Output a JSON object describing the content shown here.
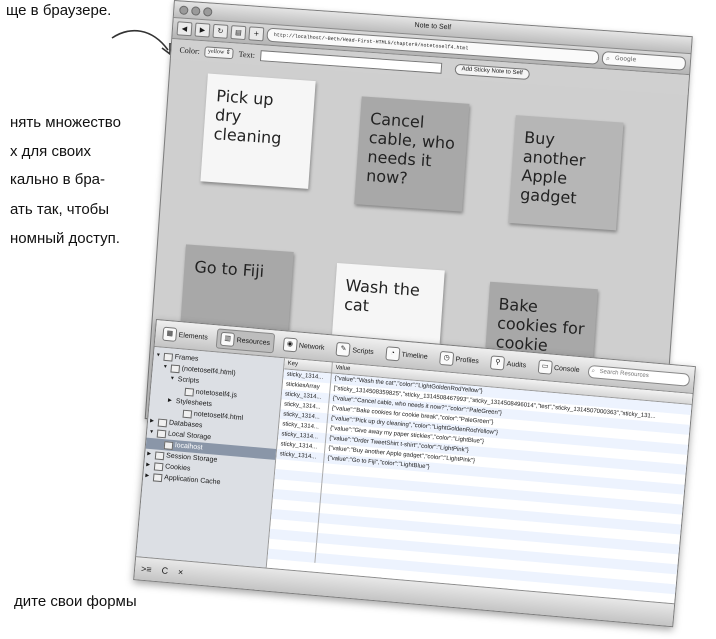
{
  "book": {
    "line1": "ще в браузере.",
    "line2": "нять множество",
    "line3": "х для своих",
    "line4": "кально в бра-",
    "line5": "ать так, чтобы",
    "line6": "номный доступ.",
    "line7": "дите свои формы"
  },
  "browser": {
    "title": "Note to Self",
    "url": "http://localhost/~Beth/Head-First-HTML5/chapter9/notetoself4.html",
    "search_placeholder": "Google",
    "nav_icons": [
      "back-icon",
      "forward-icon",
      "reload-icon",
      "bookmarks-icon",
      "add-bookmark-icon"
    ],
    "form": {
      "color_label": "Color:",
      "color_value": "yellow",
      "text_label": "Text:",
      "text_value": "",
      "add_button": "Add Sticky Note to Self"
    },
    "notes": [
      {
        "text": "Pick up dry cleaning",
        "color": "#f6f6f6"
      },
      {
        "text": "Cancel cable, who needs it now?",
        "color": "#a8a8a8"
      },
      {
        "text": "Buy another Apple gadget",
        "color": "#b6b6b6"
      },
      {
        "text": "Go to Fiji",
        "color": "#a8a8a8"
      },
      {
        "text": "Wash the cat",
        "color": "#f6f6f6"
      },
      {
        "text": "Bake cookies for cookie break",
        "color": "#a8a8a8"
      }
    ]
  },
  "devtools": {
    "tabs": [
      {
        "label": "Elements",
        "icon": "elements-icon"
      },
      {
        "label": "Resources",
        "icon": "resources-icon"
      },
      {
        "label": "Network",
        "icon": "network-icon"
      },
      {
        "label": "Scripts",
        "icon": "scripts-icon"
      },
      {
        "label": "Timeline",
        "icon": "timeline-icon"
      },
      {
        "label": "Profiles",
        "icon": "profiles-icon"
      },
      {
        "label": "Audits",
        "icon": "audits-icon"
      },
      {
        "label": "Console",
        "icon": "console-icon"
      }
    ],
    "search_placeholder": "Search Resources",
    "tree": [
      {
        "label": "Frames",
        "level": 0
      },
      {
        "label": "(notetoself4.html)",
        "level": 1
      },
      {
        "label": "Scripts",
        "level": 2
      },
      {
        "label": "notetoself4.js",
        "level": 3
      },
      {
        "label": "Stylesheets",
        "level": 2
      },
      {
        "label": "notetoself4.html",
        "level": 3
      },
      {
        "label": "Databases",
        "level": 0
      },
      {
        "label": "Local Storage",
        "level": 0
      },
      {
        "label": "localhost",
        "level": 1,
        "selected": true
      },
      {
        "label": "Session Storage",
        "level": 0
      },
      {
        "label": "Cookies",
        "level": 0
      },
      {
        "label": "Application Cache",
        "level": 0
      }
    ],
    "columns": {
      "key": "Key",
      "value": "Value"
    },
    "rows": [
      {
        "key": "sticky_1314...",
        "value": "{\"value\":\"Wash the cat\",\"color\":\"LightGoldenRodYellow\"}"
      },
      {
        "key": "stickiesArray",
        "value": "[\"sticky_1314508359825\",\"sticky_1314508467993\",\"sticky_1314508496014\",\"test\",\"sticky_1314507000363\",\"sticky_131..."
      },
      {
        "key": "sticky_1314...",
        "value": "{\"value\":\"Cancel cable, who needs it now?\",\"color\":\"PaleGreen\"}"
      },
      {
        "key": "sticky_1314...",
        "value": "{\"value\":\"Bake cookies for cookie break\",\"color\":\"PaleGreen\"}"
      },
      {
        "key": "sticky_1314...",
        "value": "{\"value\":\"Pick up dry cleaning\",\"color\":\"LightGoldenRodYellow\"}"
      },
      {
        "key": "sticky_1314...",
        "value": "{\"value\":\"Give away my paper stickies\",\"color\":\"LightBlue\"}"
      },
      {
        "key": "sticky_1314...",
        "value": "{\"value\":\"Order TweetShirt t-shirt\",\"color\":\"LightPink\"}"
      },
      {
        "key": "sticky_1314...",
        "value": "{\"value\":\"Buy another Apple gadget\",\"color\":\"LightPink\"}"
      },
      {
        "key": "sticky_1314...",
        "value": "{\"value\":\"Go to Fiji\",\"color\":\"LightBlue\"}"
      }
    ],
    "footer": {
      "refresh": "C",
      "delete": "×",
      "console_toggle": ">≡"
    }
  }
}
